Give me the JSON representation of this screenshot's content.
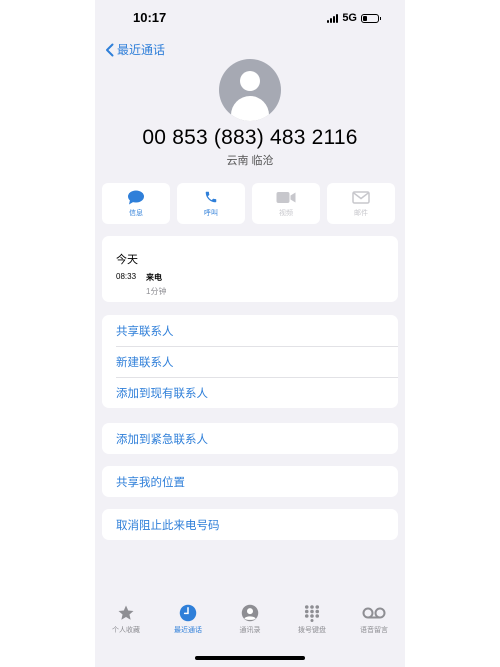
{
  "status_bar": {
    "time": "10:17",
    "network": "5G"
  },
  "nav": {
    "back_label": "最近通话"
  },
  "contact": {
    "number": "00 853 (883) 483 2116",
    "location": "云南 临沧"
  },
  "actions": [
    {
      "label": "信息",
      "icon": "message-bubble-icon",
      "enabled": true
    },
    {
      "label": "呼叫",
      "icon": "phone-icon",
      "enabled": true
    },
    {
      "label": "视频",
      "icon": "video-camera-icon",
      "enabled": false
    },
    {
      "label": "邮件",
      "icon": "mail-icon",
      "enabled": false
    }
  ],
  "recent": {
    "day": "今天",
    "time": "08:33",
    "type": "来电",
    "duration": "1分钟"
  },
  "contact_options": [
    "共享联系人",
    "新建联系人",
    "添加到现有联系人"
  ],
  "emergency_option": "添加到紧急联系人",
  "location_option": "共享我的位置",
  "unblock_option": "取消阻止此来电号码",
  "tabs": [
    {
      "label": "个人收藏",
      "icon": "star-icon",
      "active": false
    },
    {
      "label": "最近通话",
      "icon": "clock-icon",
      "active": true
    },
    {
      "label": "通讯录",
      "icon": "person-circle-icon",
      "active": false
    },
    {
      "label": "拨号键盘",
      "icon": "keypad-icon",
      "active": false
    },
    {
      "label": "语音留言",
      "icon": "voicemail-icon",
      "active": false
    }
  ],
  "colors": {
    "accent": "#2f7fd9",
    "background": "#f2f1f6",
    "inactive": "#8e8e93"
  }
}
